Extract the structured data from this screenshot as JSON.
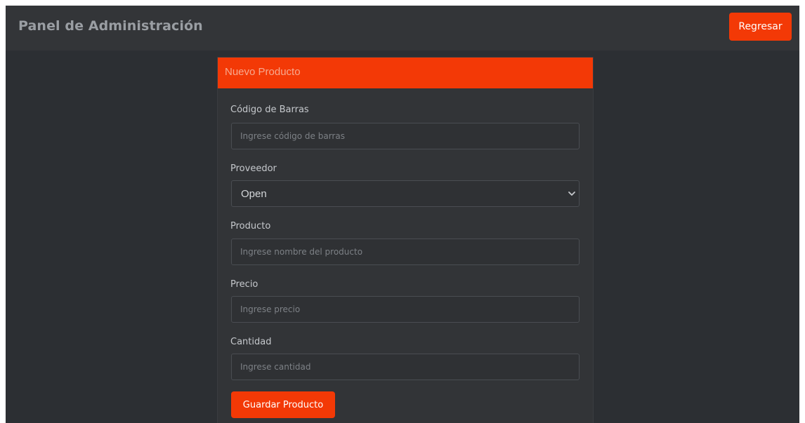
{
  "navbar": {
    "brand": "Panel de Administración",
    "back_button": "Regresar"
  },
  "form": {
    "title": "Nuevo Producto",
    "fields": {
      "barcode": {
        "label": "Código de Barras",
        "value": "",
        "placeholder": "Ingrese código de barras"
      },
      "supplier": {
        "label": "Proveedor",
        "selected": "Open"
      },
      "product": {
        "label": "Producto",
        "value": "",
        "placeholder": "Ingrese nombre del producto"
      },
      "price": {
        "label": "Precio",
        "value": "",
        "placeholder": "Ingrese precio"
      },
      "quantity": {
        "label": "Cantidad",
        "value": "",
        "placeholder": "Ingrese cantidad"
      }
    },
    "submit_button": "Guardar Producto"
  },
  "icons": {
    "select_arrow": "chevron-down-icon"
  },
  "colors": {
    "accent": "#f33906",
    "background": "#2c2f33",
    "navbar": "#333538",
    "card": "#323437",
    "card_title": "#f7a98f",
    "brand_text": "#9a9ea3"
  }
}
